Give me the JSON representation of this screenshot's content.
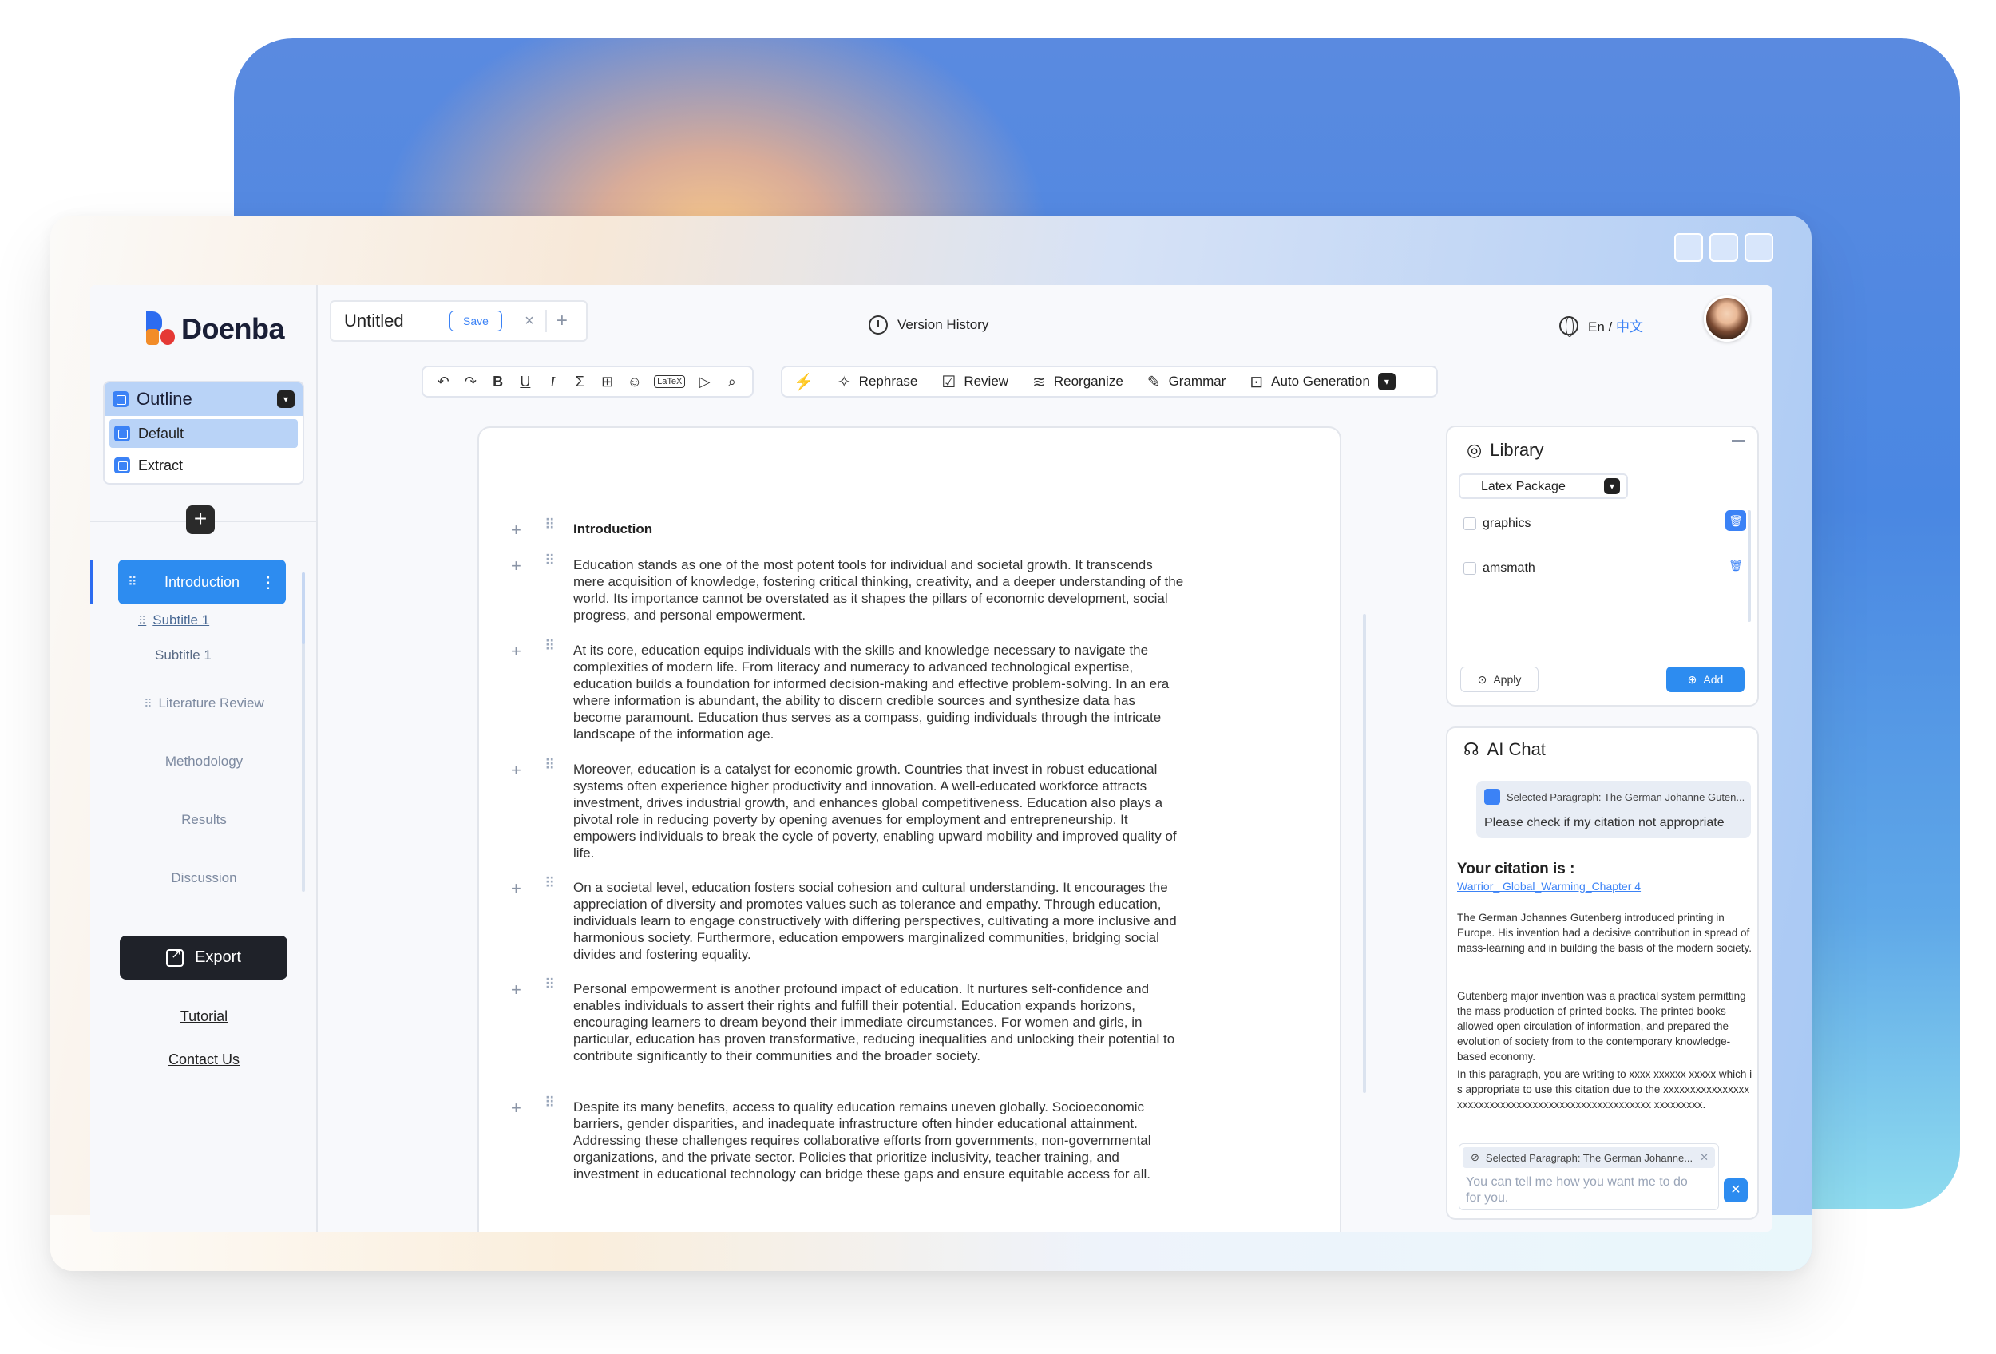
{
  "brand": {
    "name": "Doenba"
  },
  "outline": {
    "title": "Outline",
    "items": [
      {
        "label": "Default"
      },
      {
        "label": "Extract"
      }
    ]
  },
  "nav": {
    "active": "Introduction",
    "subtitles": [
      "Subtitle 1",
      "Subtitle 1"
    ],
    "items": [
      "Literature Review",
      "Methodology",
      "Results",
      "Discussion"
    ],
    "export": "Export",
    "tutorial": "Tutorial",
    "contact": "Contact Us"
  },
  "tab": {
    "title": "Untitled",
    "save": "Save",
    "close": "×",
    "add": "+"
  },
  "toolbar": {
    "format_icons": [
      "undo-icon",
      "redo-icon",
      "bold-icon",
      "underline-icon",
      "italic-icon",
      "sum-icon",
      "grid-icon",
      "emoji-icon",
      "latex-icon",
      "play-icon",
      "search-icon"
    ],
    "latex_label": "LaTeX",
    "ai_tools": [
      "Rephrase",
      "Review",
      "Reorganize",
      "Grammar",
      "Auto Generation"
    ]
  },
  "header": {
    "version_history": "Version History",
    "lang_en": "En",
    "lang_sep": " / ",
    "lang_zh": "中文"
  },
  "document": {
    "heading": "Introduction",
    "paragraphs": [
      "Education stands as one of the most potent tools for individual and societal growth. It transcends mere acquisition of knowledge, fostering critical thinking, creativity, and a deeper understanding of the world. Its importance cannot be overstated as it shapes the pillars of economic development, social progress, and personal empowerment.",
      "At its core, education equips individuals with the skills and knowledge necessary to navigate the complexities of modern life. From literacy and numeracy to advanced technological expertise, education builds a foundation for informed decision-making and effective problem-solving. In an era where information is abundant, the ability to discern credible sources and synthesize data has become paramount. Education thus serves as a compass, guiding individuals through the intricate landscape of the information age.",
      "Moreover, education is a catalyst for economic growth. Countries that invest in robust educational systems often experience higher productivity and innovation. A well-educated workforce attracts investment, drives industrial growth, and enhances global competitiveness. Education also plays a pivotal role in reducing poverty by opening avenues for employment and entrepreneurship. It empowers individuals to break the cycle of poverty, enabling upward mobility and improved quality of life.",
      "On a societal level, education fosters social cohesion and cultural understanding. It encourages the appreciation of diversity and promotes values such as tolerance and empathy. Through education, individuals learn to engage constructively with differing perspectives, cultivating a more inclusive and harmonious society. Furthermore, education empowers marginalized communities, bridging social divides and fostering equality.",
      "Personal empowerment is another profound impact of education. It nurtures self-confidence and enables individuals to assert their rights and fulfill their potential. Education expands horizons, encouraging learners to dream beyond their immediate circumstances. For women and girls, in particular, education has proven transformative, reducing inequalities and unlocking their potential to contribute significantly to their communities and the broader society.",
      "Despite its many benefits, access to quality education remains uneven globally. Socioeconomic barriers, gender disparities, and inadequate infrastructure often hinder educational attainment. Addressing these challenges requires collaborative efforts from governments, non-governmental organizations, and the private sector. Policies that prioritize inclusivity, teacher training, and investment in educational technology can bridge these gaps and ensure equitable access for all."
    ]
  },
  "library": {
    "title": "Library",
    "package_select": "Latex Package",
    "packages": [
      "graphics",
      "amsmath"
    ],
    "apply": "Apply",
    "add": "Add"
  },
  "chat": {
    "title": "AI Chat",
    "selected_label": "Selected Paragraph: The German Johanne Guten...",
    "user_message": "Please check if my citation not appropriate",
    "citation_heading": "Your citation is :",
    "citation_link": "Warrior_ Global_Warming_Chapter 4",
    "reply_paragraphs": [
      "The German Johannes Gutenberg introduced printing in Europe. His invention had a decisive contribution in spread of mass-learning and in building the basis of the modern society.",
      "Gutenberg major invention was a practical system permitting the mass production of printed books. The printed books allowed open circulation of information, and prepared the evolution of society from to the contemporary knowledge-based economy.",
      "In this paragraph, you are writing to xxxx xxxxxx xxxxx which is appropriate to use this citation due to the xxxxxxxxxxxxxxxxxxxxxxxxxxxxxxxxxxxxxxxxxxxxxxxxxxxx xxxxxxxxx."
    ],
    "input_chip": "Selected Paragraph: The German Johanne...",
    "input_placeholder": "You can tell me how you want me to do for you."
  },
  "colors": {
    "accent": "#2d8cf0",
    "dark_button": "#1f2229",
    "backdrop_top": "#4a87e2",
    "backdrop_bottom": "#8fdcef"
  }
}
